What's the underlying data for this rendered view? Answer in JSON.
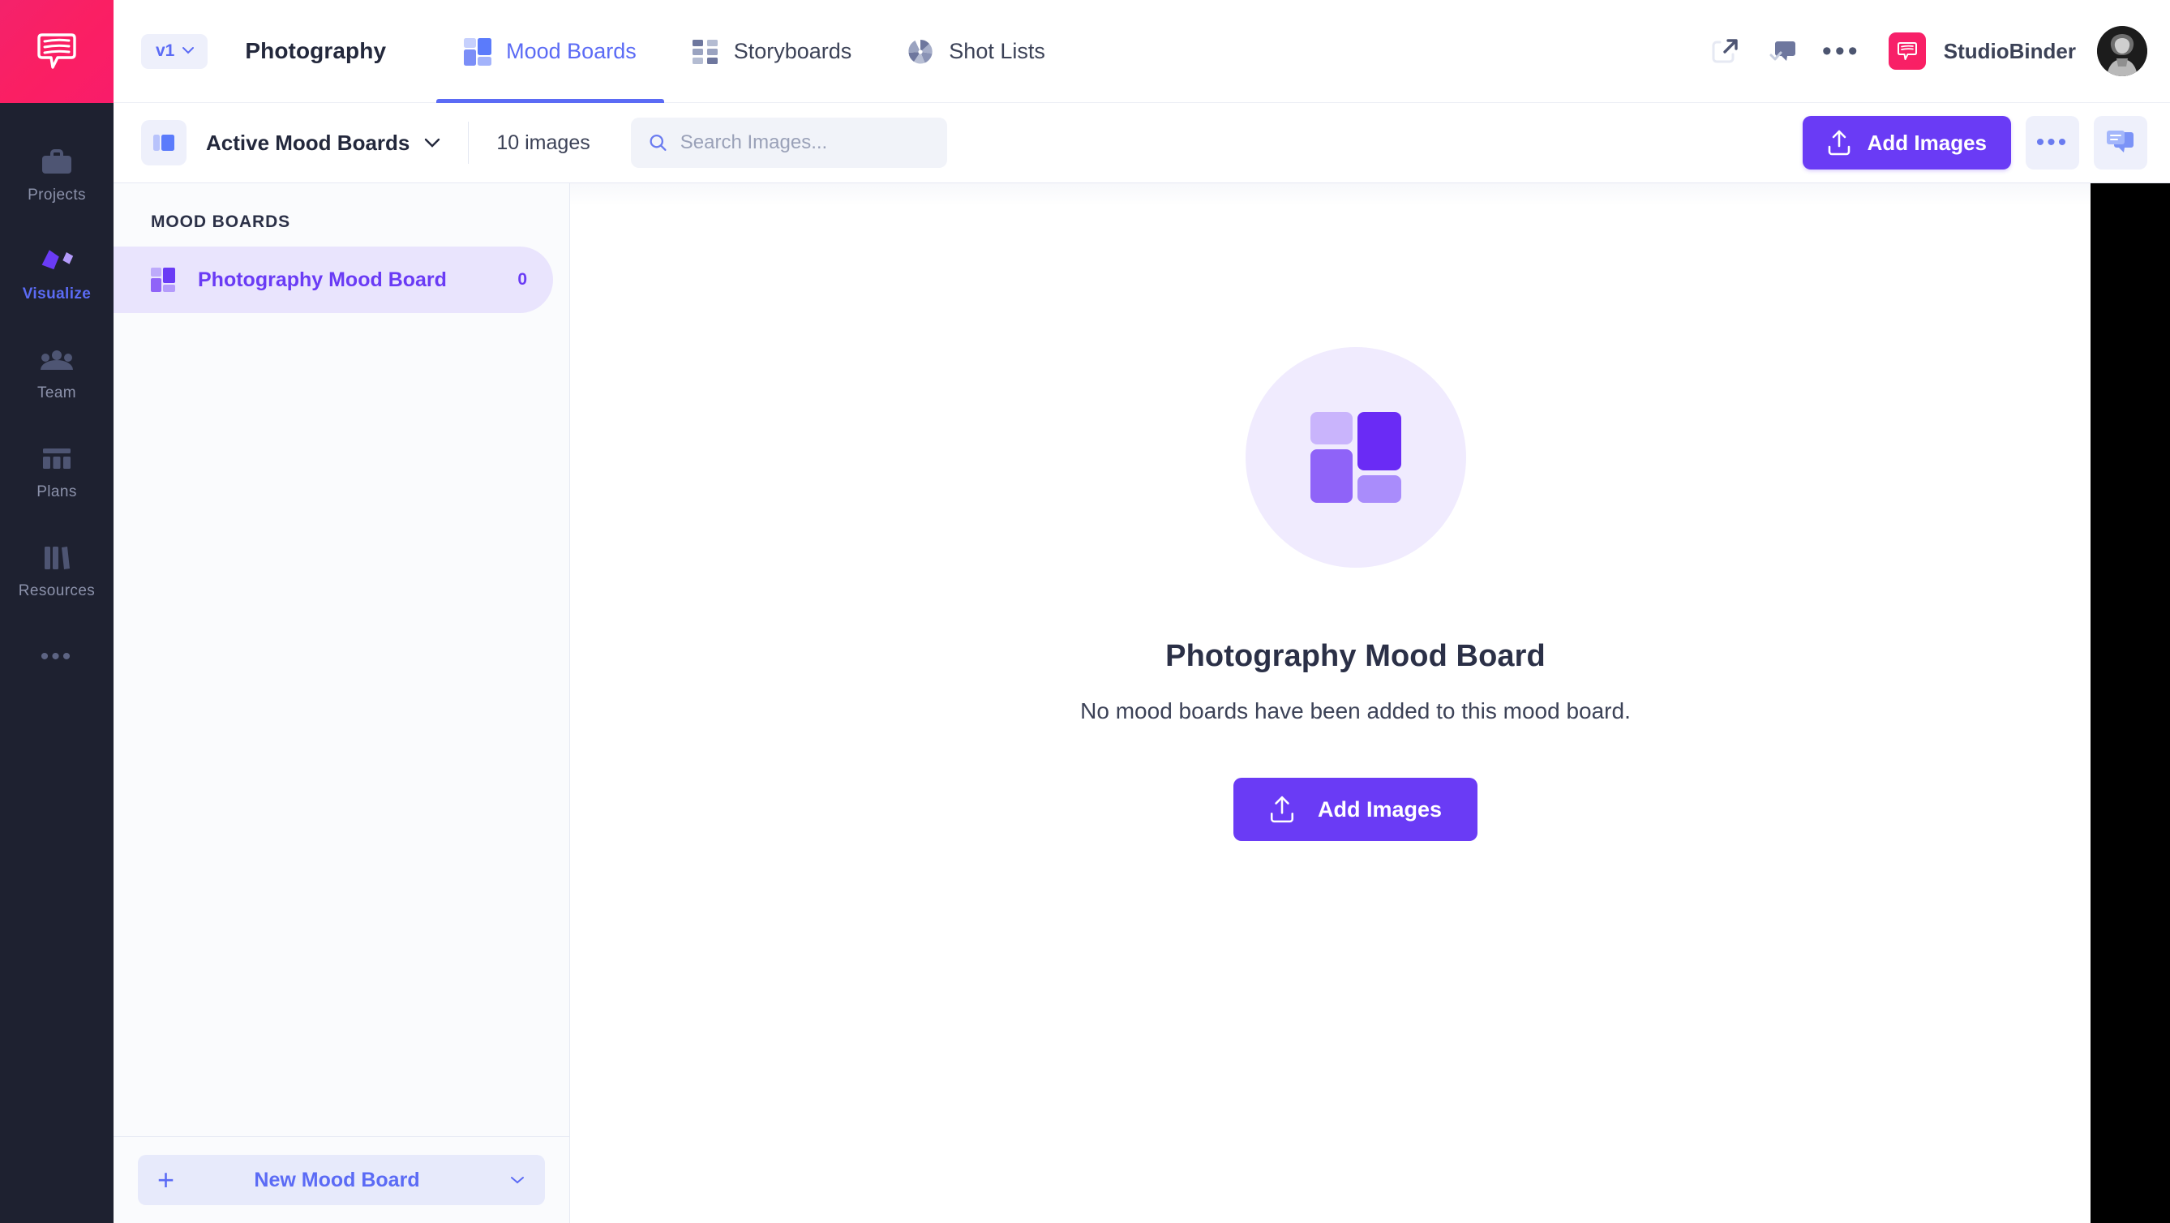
{
  "colors": {
    "brand_pink": "#fa1f63",
    "accent_purple": "#6a3bf5",
    "accent_blue": "#5b6bf5",
    "rail_bg": "#1e2130",
    "selected_row": "#e9e4fd"
  },
  "rail": {
    "logo_icon": "studiobinder-speech-bubble-logo",
    "items": [
      {
        "label": "Projects",
        "icon": "briefcase-icon",
        "active": false
      },
      {
        "label": "Visualize",
        "icon": "diamonds-icon",
        "active": true
      },
      {
        "label": "Team",
        "icon": "people-icon",
        "active": false
      },
      {
        "label": "Plans",
        "icon": "calendar-bars-icon",
        "active": false
      },
      {
        "label": "Resources",
        "icon": "books-icon",
        "active": false
      }
    ],
    "more_label": "•••"
  },
  "topbar": {
    "version": "v1",
    "version_caret": "chevron-down-icon",
    "project_title": "Photography",
    "tabs": [
      {
        "label": "Mood Boards",
        "icon": "mood-board-icon",
        "active": true
      },
      {
        "label": "Storyboards",
        "icon": "storyboard-grid-icon",
        "active": false
      },
      {
        "label": "Shot Lists",
        "icon": "aperture-icon",
        "active": false
      }
    ],
    "actions": [
      {
        "name": "share-icon"
      },
      {
        "name": "comment-check-icon"
      },
      {
        "name": "more-options-icon",
        "label": "•••"
      }
    ],
    "brand_badge_icon": "studiobinder-badge-icon",
    "account_name": "StudioBinder",
    "avatar_icon": "user-avatar"
  },
  "toolbar": {
    "view_icon": "panel-toggle-icon",
    "filter_label": "Active Mood Boards",
    "filter_caret": "chevron-down-icon",
    "image_count": "10 images",
    "search": {
      "icon": "search-icon",
      "value": "",
      "placeholder": "Search Images..."
    },
    "add_images_label": "Add Images",
    "add_images_icon": "upload-icon",
    "more_label": "•••",
    "comments_icon": "comments-icon"
  },
  "list_panel": {
    "header": "MOOD BOARDS",
    "items": [
      {
        "label": "Photography Mood Board",
        "count": "0",
        "icon": "mood-board-icon",
        "selected": true
      }
    ],
    "new_button": {
      "label": "New Mood Board",
      "plus": "+",
      "caret": "chevron-down-icon"
    }
  },
  "empty_state": {
    "icon": "mood-board-large-icon",
    "title": "Photography Mood Board",
    "subtitle": "No mood boards have been added to this mood board.",
    "button_label": "Add Images",
    "button_icon": "upload-icon"
  }
}
